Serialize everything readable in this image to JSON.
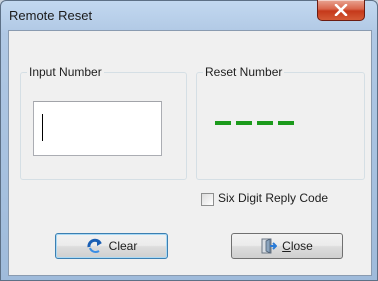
{
  "window": {
    "title": "Remote Reset"
  },
  "input_group": {
    "label": "Input Number",
    "value": ""
  },
  "reset_group": {
    "label": "Reset Number",
    "code_display": "----"
  },
  "checkbox": {
    "label": "Six Digit Reply Code",
    "checked": false
  },
  "buttons": {
    "clear_label": "Clear",
    "close_mnemonic": "C",
    "close_rest": "lose"
  },
  "colors": {
    "code_dash": "#1b9a1b",
    "close_button": "#c5391b"
  }
}
